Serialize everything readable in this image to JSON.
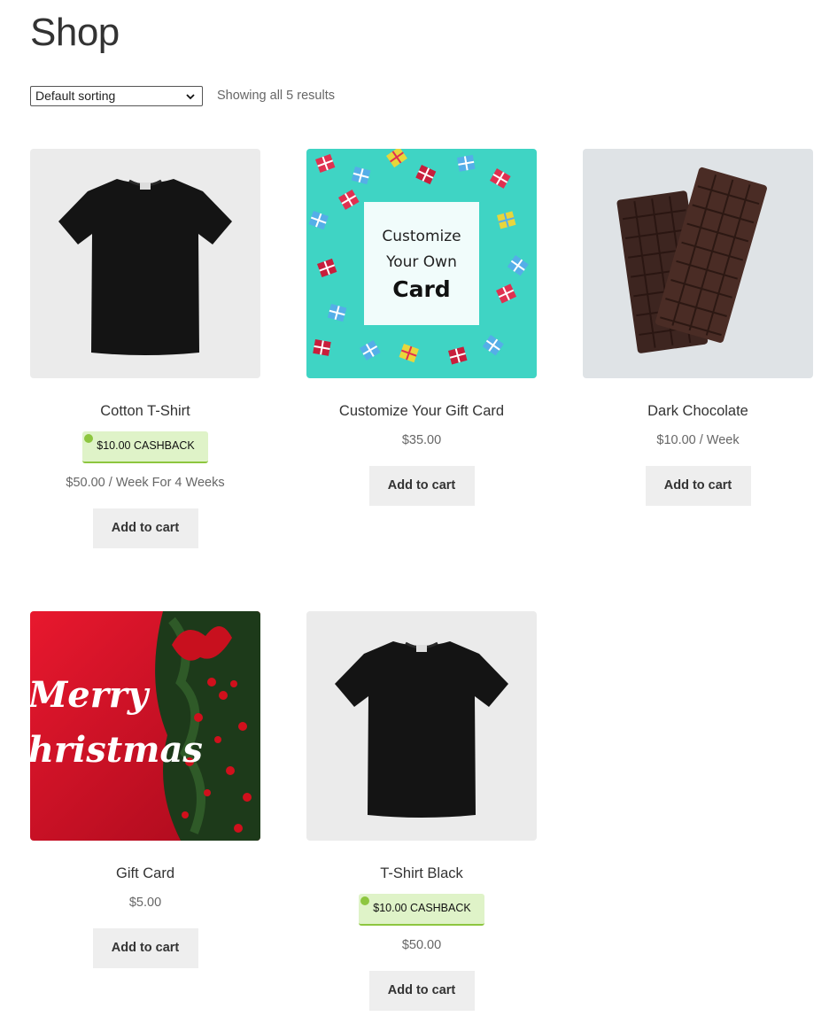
{
  "page": {
    "title": "Shop"
  },
  "toolbar": {
    "sorting_value": "Default sorting",
    "result_count": "Showing all 5 results"
  },
  "products": [
    {
      "title": "Cotton T-Shirt",
      "cashback": "$10.00 CASHBACK",
      "price": "$50.00 / Week For 4 Weeks",
      "button": "Add to cart"
    },
    {
      "title": "Customize Your Gift Card",
      "price": "$35.00",
      "button": "Add to cart",
      "image_text": {
        "line1": "Customize",
        "line2": "Your Own",
        "line3": "Card"
      }
    },
    {
      "title": "Dark Chocolate",
      "price": "$10.00 / Week",
      "button": "Add to cart"
    },
    {
      "title": "Gift Card",
      "price": "$5.00",
      "button": "Add to cart",
      "image_text": {
        "line1": "Merry",
        "line2": "Christmas"
      }
    },
    {
      "title": "T-Shirt Black",
      "cashback": "$10.00 CASHBACK",
      "price": "$50.00",
      "button": "Add to cart"
    }
  ],
  "colors": {
    "cashback_bg": "#dff3c8",
    "cashback_accent": "#8dc63f",
    "button_bg": "#eeeeee",
    "giftcard_bg": "#3fd4c4",
    "xmas_red": "#d8132a"
  }
}
